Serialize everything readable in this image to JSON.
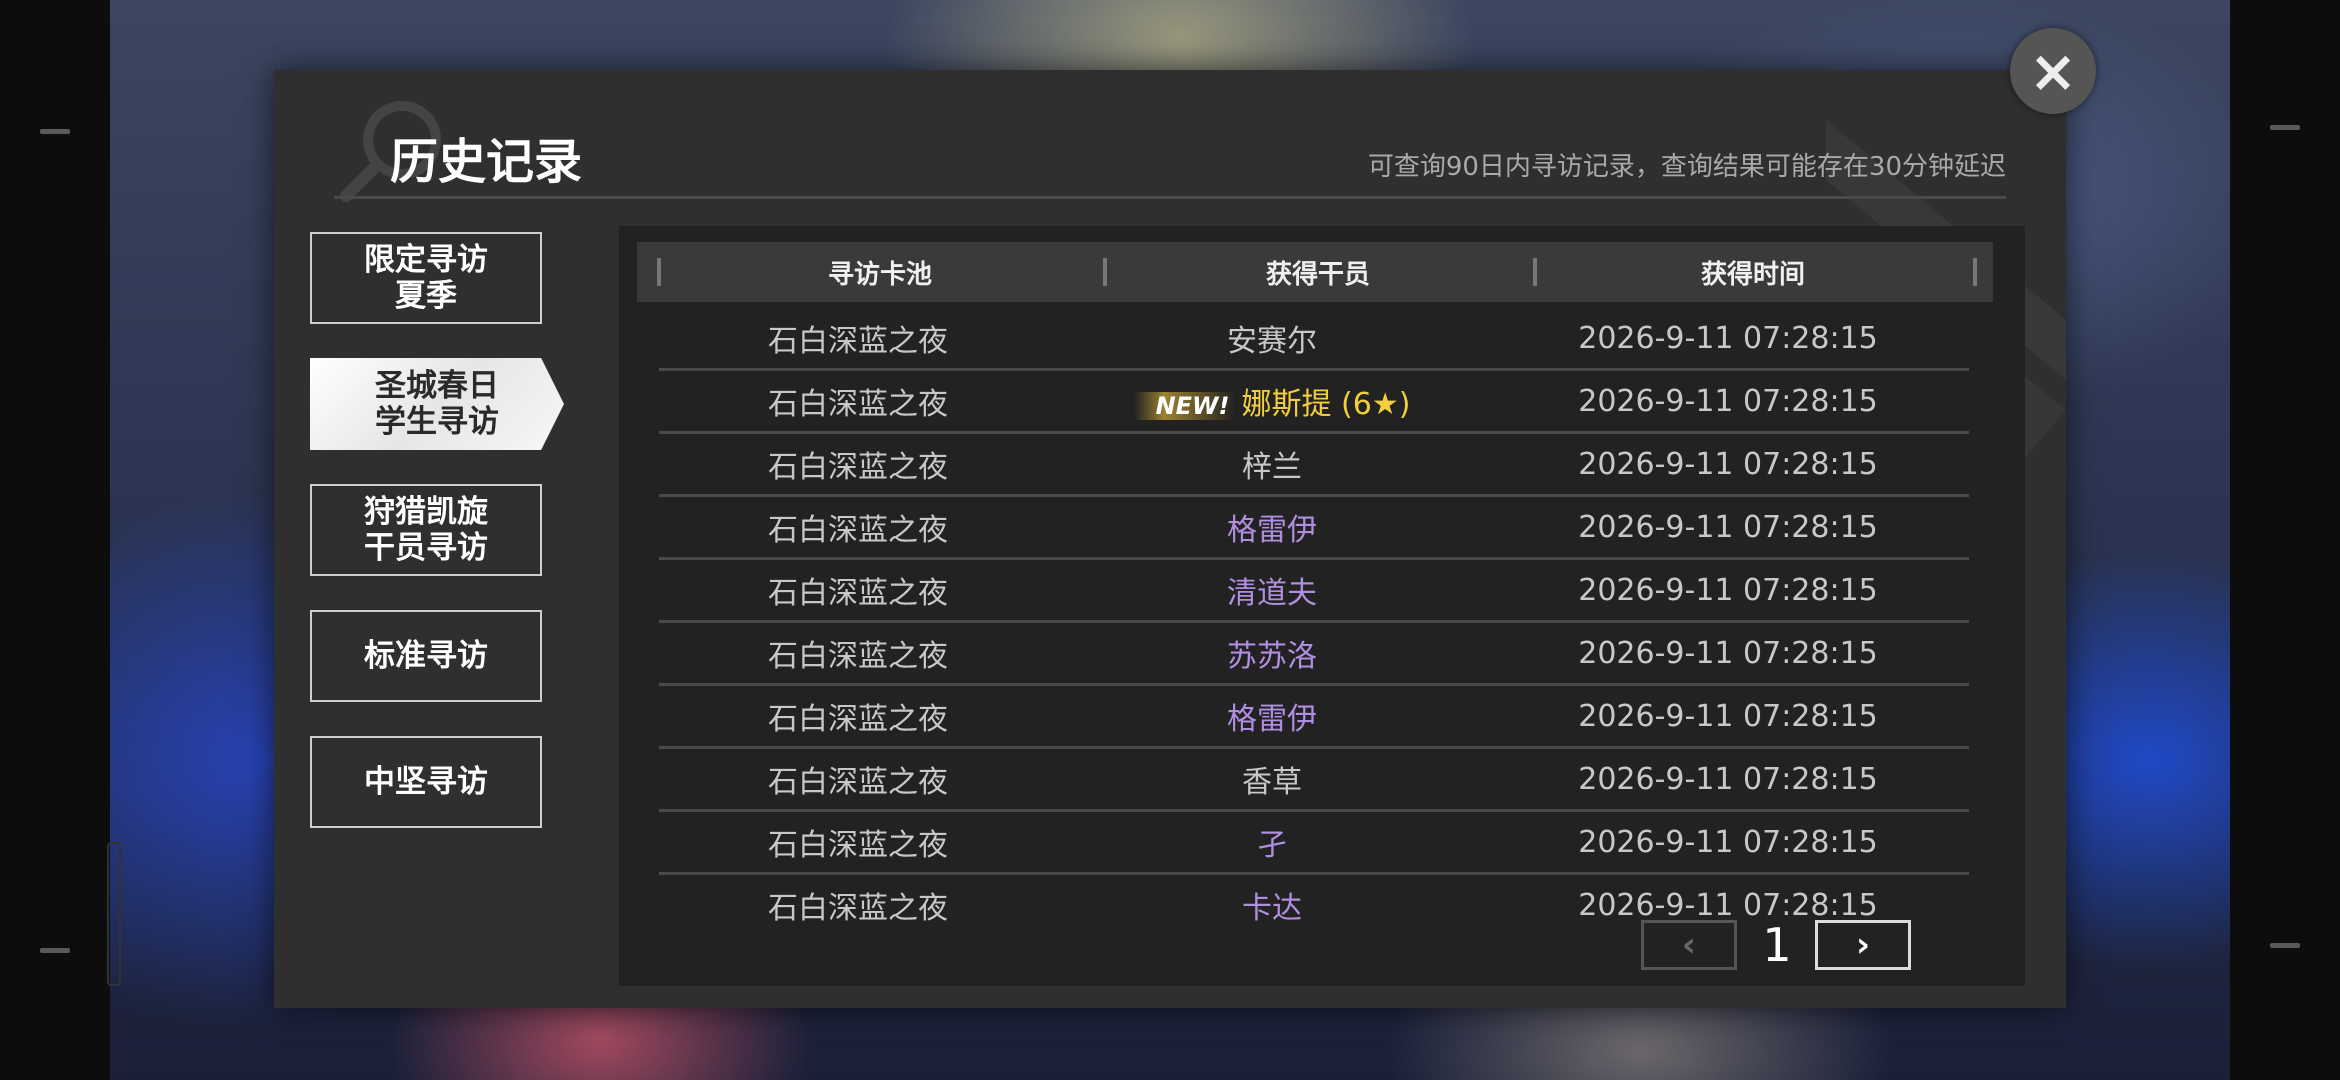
{
  "dialog": {
    "title": "历史记录",
    "subtitle": "可查询90日内寻访记录，查询结果可能存在30分钟延迟",
    "close_icon": "×"
  },
  "tabs": [
    {
      "line1": "限定寻访",
      "line2": "夏季",
      "active": false
    },
    {
      "line1": "圣城春日",
      "line2": "学生寻访",
      "active": true
    },
    {
      "line1": "狩猎凯旋",
      "line2": "干员寻访",
      "active": false
    },
    {
      "line1": "标准寻访",
      "line2": "",
      "active": false
    },
    {
      "line1": "中坚寻访",
      "line2": "",
      "active": false
    }
  ],
  "table": {
    "headers": [
      "寻访卡池",
      "获得干员",
      "获得时间"
    ],
    "rows": [
      {
        "pool": "石白深蓝之夜",
        "operator": "安赛尔",
        "time": "2026-9-11 07:28:15",
        "rarity_color": "#c8c8c8",
        "new": ""
      },
      {
        "pool": "石白深蓝之夜",
        "operator": "娜斯提 (6★)",
        "time": "2026-9-11 07:28:15",
        "rarity_color": "#f3cf3f",
        "new": "NEW!"
      },
      {
        "pool": "石白深蓝之夜",
        "operator": "梓兰",
        "time": "2026-9-11 07:28:15",
        "rarity_color": "#c8c8c8",
        "new": ""
      },
      {
        "pool": "石白深蓝之夜",
        "operator": "格雷伊",
        "time": "2026-9-11 07:28:15",
        "rarity_color": "#b08ee0",
        "new": ""
      },
      {
        "pool": "石白深蓝之夜",
        "operator": "清道夫",
        "time": "2026-9-11 07:28:15",
        "rarity_color": "#b08ee0",
        "new": ""
      },
      {
        "pool": "石白深蓝之夜",
        "operator": "苏苏洛",
        "time": "2026-9-11 07:28:15",
        "rarity_color": "#b08ee0",
        "new": ""
      },
      {
        "pool": "石白深蓝之夜",
        "operator": "格雷伊",
        "time": "2026-9-11 07:28:15",
        "rarity_color": "#b08ee0",
        "new": ""
      },
      {
        "pool": "石白深蓝之夜",
        "operator": "香草",
        "time": "2026-9-11 07:28:15",
        "rarity_color": "#c8c8c8",
        "new": ""
      },
      {
        "pool": "石白深蓝之夜",
        "operator": "孑",
        "time": "2026-9-11 07:28:15",
        "rarity_color": "#b08ee0",
        "new": ""
      },
      {
        "pool": "石白深蓝之夜",
        "operator": "卡达",
        "time": "2026-9-11 07:28:15",
        "rarity_color": "#b08ee0",
        "new": ""
      }
    ]
  },
  "pager": {
    "page": "1",
    "prev_icon": "‹",
    "next_icon": "›"
  }
}
